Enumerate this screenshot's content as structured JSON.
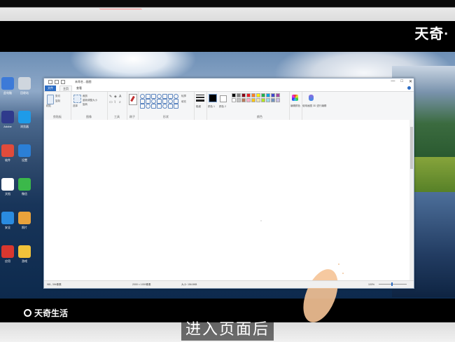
{
  "subtitle": "进入页面后",
  "watermark": "天奇·",
  "brand": "天奇生活",
  "colors": {
    "accent": "#2b6cc4",
    "canvas": "#ffffff",
    "brush_blob": "#f5c396"
  },
  "paint": {
    "title": "未命名 - 画图",
    "tabs": [
      {
        "label": "文件",
        "icon": ""
      },
      {
        "label": "主页",
        "icon": ""
      },
      {
        "label": "查看",
        "icon": ""
      }
    ],
    "window_buttons": {
      "minimize": "—",
      "maximize": "□",
      "close": "✕"
    },
    "ribbon": {
      "clipboard": {
        "label": "剪贴板",
        "paste": "粘贴",
        "cut": "剪切",
        "copy": "复制"
      },
      "image": {
        "label": "图像",
        "select": "选择",
        "crop": "裁剪",
        "resize": "重新调整大小",
        "rotate": "旋转"
      },
      "tools": {
        "label": "工具"
      },
      "brushes": {
        "label": "刷子"
      },
      "shapes": {
        "label": "形状",
        "outline": "轮廓",
        "fill": "填充"
      },
      "size": {
        "label": "粗细"
      },
      "color1": {
        "label": "颜色 1"
      },
      "color2": {
        "label": "颜色 2"
      },
      "colors_label": "颜色",
      "edit_colors": "编辑颜色",
      "paint3d": "使用画图 3D 进行编辑"
    },
    "palette": [
      "#000000",
      "#7f7f7f",
      "#880015",
      "#ed1c24",
      "#ff7f27",
      "#fff200",
      "#22b14c",
      "#00a2e8",
      "#3f48cc",
      "#a349a4",
      "#ffffff",
      "#c3c3c3",
      "#b97a57",
      "#ffaec9",
      "#ffc90e",
      "#efe4b0",
      "#b5e61d",
      "#99d9ea",
      "#7092be",
      "#c8bfe7"
    ],
    "status": {
      "position": "981, 394像素",
      "selection": "",
      "canvas_size": "2000 × 1000像素",
      "file_size": "大小: 156.8KB",
      "zoom": "100%"
    }
  },
  "desktop_icons": [
    {
      "label": "此电脑",
      "color": "#3d7ad8"
    },
    {
      "label": "回收站",
      "color": "#cfd6de"
    },
    {
      "label": "Adobe",
      "color": "#2f3a8c"
    },
    {
      "label": "浏览器",
      "color": "#1e9be8"
    },
    {
      "label": "软件",
      "color": "#e04b3b"
    },
    {
      "label": "设置",
      "color": "#2b7fd6"
    },
    {
      "label": "文档",
      "color": "#ffffff"
    },
    {
      "label": "微信",
      "color": "#3bb84a"
    },
    {
      "label": "安全",
      "color": "#2a8be0"
    },
    {
      "label": "照片",
      "color": "#e9a23b"
    },
    {
      "label": "应用",
      "color": "#d8372f"
    },
    {
      "label": "游戏",
      "color": "#f0c23a"
    }
  ]
}
